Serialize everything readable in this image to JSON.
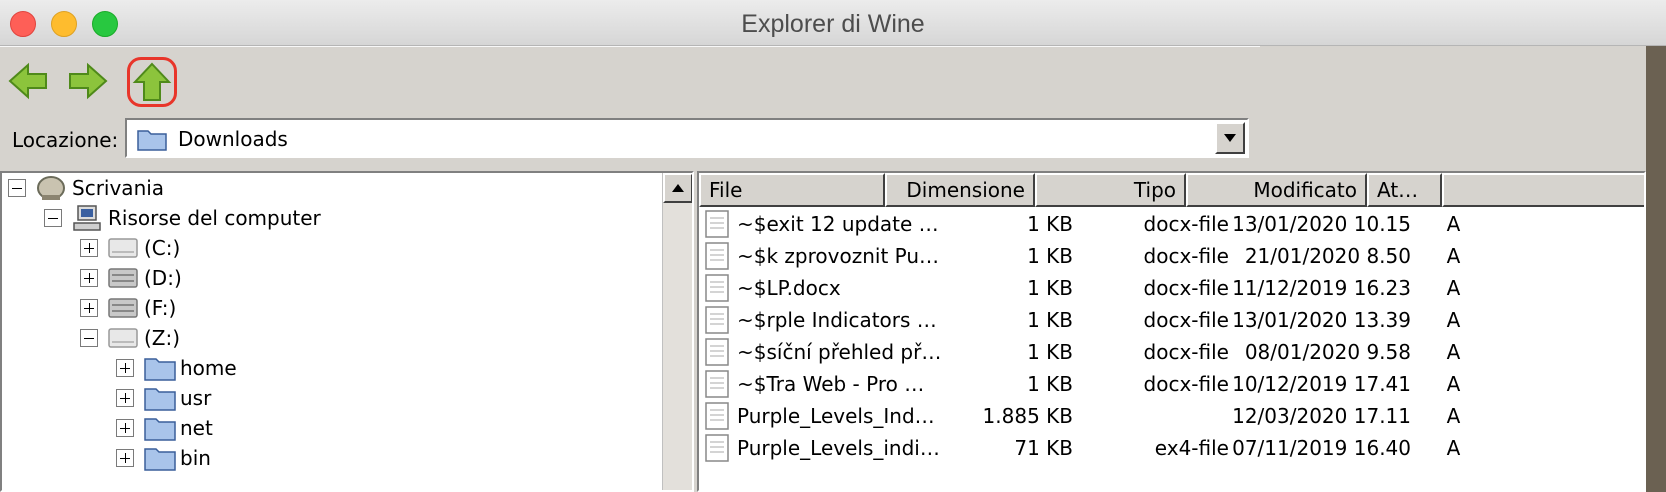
{
  "window": {
    "title": "Explorer di Wine"
  },
  "toolbar": {
    "back_icon": "back-arrow-icon",
    "forward_icon": "forward-arrow-icon",
    "up_icon": "up-arrow-icon",
    "highlight_color": "#e8352a",
    "arrow_color": "#74b02c"
  },
  "location": {
    "label": "Locazione:",
    "value": "Downloads"
  },
  "tree": {
    "items": [
      {
        "label": "Scrivania",
        "expanded": true,
        "icon": "desktop-icon"
      },
      {
        "label": "Risorse del computer",
        "expanded": true,
        "icon": "computer-icon"
      },
      {
        "label": "(C:)",
        "expanded": false,
        "icon": "drive-icon"
      },
      {
        "label": "(D:)",
        "expanded": false,
        "icon": "drive-icon"
      },
      {
        "label": "(F:)",
        "expanded": false,
        "icon": "drive-icon"
      },
      {
        "label": "(Z:)",
        "expanded": true,
        "icon": "drive-icon"
      },
      {
        "label": "home",
        "expanded": false,
        "icon": "folder-icon"
      },
      {
        "label": "usr",
        "expanded": false,
        "icon": "folder-icon"
      },
      {
        "label": "net",
        "expanded": false,
        "icon": "folder-icon"
      },
      {
        "label": "bin",
        "expanded": false,
        "icon": "folder-icon"
      }
    ]
  },
  "list": {
    "columns": [
      "File",
      "Dimensione",
      "Tipo",
      "Modificato",
      "At…"
    ],
    "rows": [
      {
        "name": "~$exit 12 update …",
        "size": "1 KB",
        "type": "docx-file",
        "modified": "13/01/2020 10.15",
        "attr": "A"
      },
      {
        "name": "~$k zprovoznit Pu…",
        "size": "1 KB",
        "type": "docx-file",
        "modified": "21/01/2020 8.50",
        "attr": "A"
      },
      {
        "name": "~$LP.docx",
        "size": "1 KB",
        "type": "docx-file",
        "modified": "11/12/2019 16.23",
        "attr": "A"
      },
      {
        "name": "~$rple Indicators …",
        "size": "1 KB",
        "type": "docx-file",
        "modified": "13/01/2020 13.39",
        "attr": "A"
      },
      {
        "name": "~$síční přehled př…",
        "size": "1 KB",
        "type": "docx-file",
        "modified": "08/01/2020 9.58",
        "attr": "A"
      },
      {
        "name": "~$Tra Web - Pro …",
        "size": "1 KB",
        "type": "docx-file",
        "modified": "10/12/2019 17.41",
        "attr": "A"
      },
      {
        "name": "Purple_Levels_Ind…",
        "size": "1.885 KB",
        "type": "",
        "modified": "12/03/2020 17.11",
        "attr": "A"
      },
      {
        "name": "Purple_Levels_indi…",
        "size": "71 KB",
        "type": "ex4-file",
        "modified": "07/11/2019 16.40",
        "attr": "A"
      }
    ]
  }
}
